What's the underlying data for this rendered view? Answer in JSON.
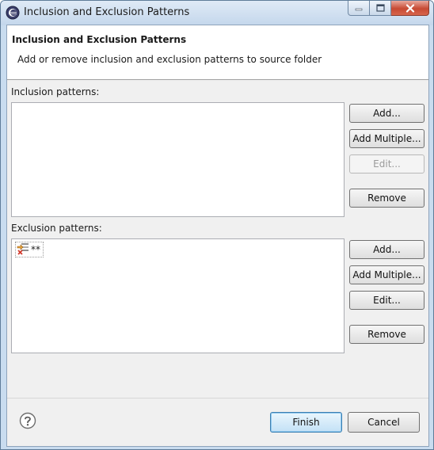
{
  "window": {
    "title": "Inclusion and Exclusion Patterns"
  },
  "header": {
    "title": "Inclusion and Exclusion Patterns",
    "description": "Add or remove inclusion and exclusion patterns to source folder"
  },
  "inclusion": {
    "label": "Inclusion patterns:",
    "items": [],
    "buttons": {
      "add": "Add...",
      "add_multiple": "Add Multiple...",
      "edit": "Edit...",
      "remove": "Remove"
    }
  },
  "exclusion": {
    "label": "Exclusion patterns:",
    "items": [
      {
        "pattern": "**",
        "icon": "exclusion-pattern-icon"
      }
    ],
    "buttons": {
      "add": "Add...",
      "add_multiple": "Add Multiple...",
      "edit": "Edit...",
      "remove": "Remove"
    }
  },
  "footer": {
    "help_icon": "question-mark-icon",
    "finish": "Finish",
    "cancel": "Cancel"
  }
}
